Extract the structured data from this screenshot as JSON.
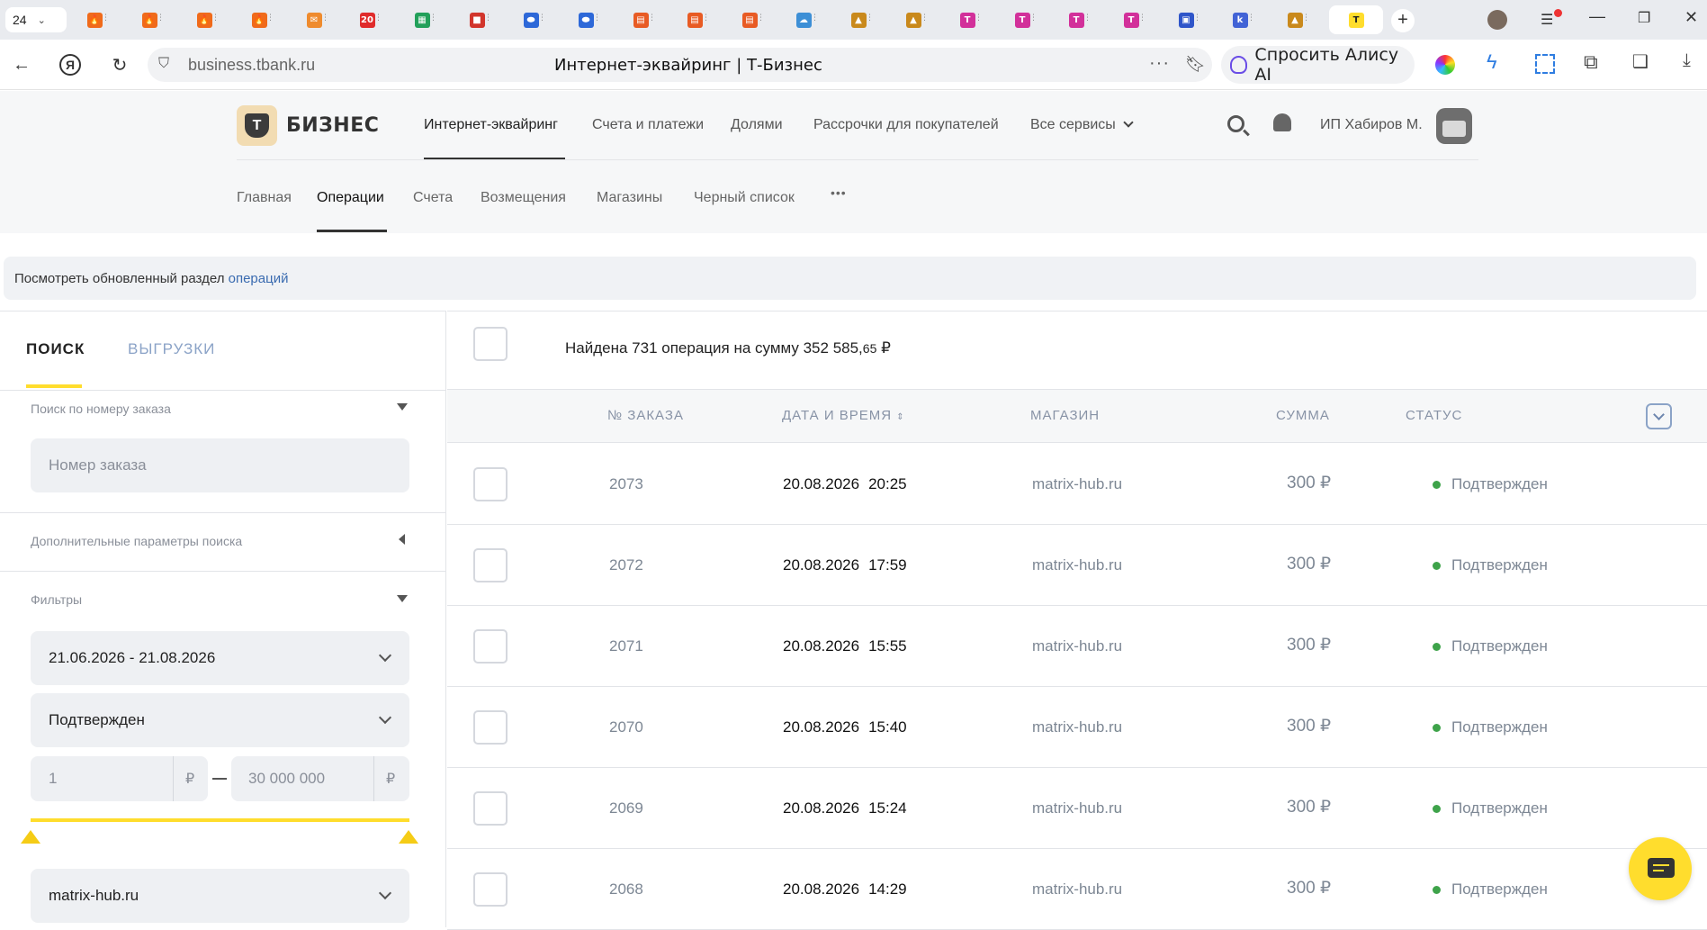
{
  "browser": {
    "tab_counter": "24",
    "url": "business.tbank.ru",
    "page_title": "Интернет-эквайринг | Т-Бизнес",
    "alice_label": "Спросить Алису AI",
    "tab_favicons": [
      {
        "name": "tab-fire-1",
        "color": "#f06a1a",
        "glyph": "🔥"
      },
      {
        "name": "tab-fire-2",
        "color": "#f06a1a",
        "glyph": "🔥"
      },
      {
        "name": "tab-fire-3",
        "color": "#f06a1a",
        "glyph": "🔥"
      },
      {
        "name": "tab-fire-4",
        "color": "#f06a1a",
        "glyph": "🔥"
      },
      {
        "name": "tab-mail",
        "color": "#ef8b2e",
        "glyph": "✉"
      },
      {
        "name": "tab-calendar-20",
        "color": "#e02b2b",
        "glyph": "20"
      },
      {
        "name": "tab-sheet",
        "color": "#22a05a",
        "glyph": "▦"
      },
      {
        "name": "tab-red-app",
        "color": "#d2352c",
        "glyph": "■"
      },
      {
        "name": "tab-blue-1",
        "color": "#2d68d8",
        "glyph": "⬬"
      },
      {
        "name": "tab-blue-2",
        "color": "#2d68d8",
        "glyph": "⬬"
      },
      {
        "name": "tab-pdf-1",
        "color": "#e85b24",
        "glyph": "▤"
      },
      {
        "name": "tab-pdf-2",
        "color": "#e85b24",
        "glyph": "▤"
      },
      {
        "name": "tab-pdf-3",
        "color": "#e85b24",
        "glyph": "▤"
      },
      {
        "name": "tab-cloud",
        "color": "#3d8fd6",
        "glyph": "☁"
      },
      {
        "name": "tab-pma-1",
        "color": "#c9891c",
        "glyph": "▲"
      },
      {
        "name": "tab-pma-2",
        "color": "#c9891c",
        "glyph": "▲"
      },
      {
        "name": "tab-shield-1",
        "color": "#d2309a",
        "glyph": "T"
      },
      {
        "name": "tab-shield-2",
        "color": "#d2309a",
        "glyph": "T"
      },
      {
        "name": "tab-shield-3",
        "color": "#d2309a",
        "glyph": "T"
      },
      {
        "name": "tab-shield-4",
        "color": "#d2309a",
        "glyph": "T"
      },
      {
        "name": "tab-doc",
        "color": "#2f55c9",
        "glyph": "▣"
      },
      {
        "name": "tab-k",
        "color": "#4263d6",
        "glyph": "k"
      },
      {
        "name": "tab-pma-3",
        "color": "#c9891c",
        "glyph": "▲"
      },
      {
        "name": "tab-tbank-active",
        "color": "#ffdd2d",
        "glyph": "T"
      }
    ]
  },
  "header": {
    "logo_text": "БИЗНЕС",
    "logo_mark": "Т",
    "nav": [
      "Интернет-эквайринг",
      "Счета и платежи",
      "Долями",
      "Рассрочки для покупателей",
      "Все сервисы"
    ],
    "user_name": "ИП Хабиров М.",
    "subnav": [
      "Главная",
      "Операции",
      "Счета",
      "Возмещения",
      "Магазины",
      "Черный список"
    ],
    "subnav_more": "•••"
  },
  "banner": {
    "text": "Посмотреть обновленный раздел ",
    "link": "операций"
  },
  "left": {
    "tab_search": "ПОИСК",
    "tab_exports": "ВЫГРУЗКИ",
    "order_search_label": "Поиск по номеру заказа",
    "order_placeholder": "Номер заказа",
    "extra_params_label": "Дополнительные параметры поиска",
    "filters_label": "Фильтры",
    "date_range": "21.06.2026 - 21.08.2026",
    "status_value": "Подтвержден",
    "amount_from": "1",
    "amount_to": "30 000 000",
    "currency": "₽",
    "shop_value": "matrix-hub.ru"
  },
  "summary": {
    "prefix": "Найдена 731 операция на сумму 352 585,",
    "kopecks": "65",
    "currency": " ₽"
  },
  "table": {
    "headers": {
      "order": "№ ЗАКАЗА",
      "date": "ДАТА И ВРЕМЯ",
      "shop": "МАГАЗИН",
      "sum": "СУММА",
      "status": "СТАТУС"
    },
    "rows": [
      {
        "order": "2073",
        "date": "20.08.2026",
        "time": "20:25",
        "shop": "matrix-hub.ru",
        "sum": "300 ₽",
        "status": "Подтвержден"
      },
      {
        "order": "2072",
        "date": "20.08.2026",
        "time": "17:59",
        "shop": "matrix-hub.ru",
        "sum": "300 ₽",
        "status": "Подтвержден"
      },
      {
        "order": "2071",
        "date": "20.08.2026",
        "time": "15:55",
        "shop": "matrix-hub.ru",
        "sum": "300 ₽",
        "status": "Подтвержден"
      },
      {
        "order": "2070",
        "date": "20.08.2026",
        "time": "15:40",
        "shop": "matrix-hub.ru",
        "sum": "300 ₽",
        "status": "Подтвержден"
      },
      {
        "order": "2069",
        "date": "20.08.2026",
        "time": "15:24",
        "shop": "matrix-hub.ru",
        "sum": "300 ₽",
        "status": "Подтвержден"
      },
      {
        "order": "2068",
        "date": "20.08.2026",
        "time": "14:29",
        "shop": "matrix-hub.ru",
        "sum": "300 ₽",
        "status": "Подтвержден"
      }
    ]
  },
  "colors": {
    "brand_yellow": "#ffdd2d",
    "status_green": "#3ea34a",
    "link_blue": "#3a6bb0"
  }
}
